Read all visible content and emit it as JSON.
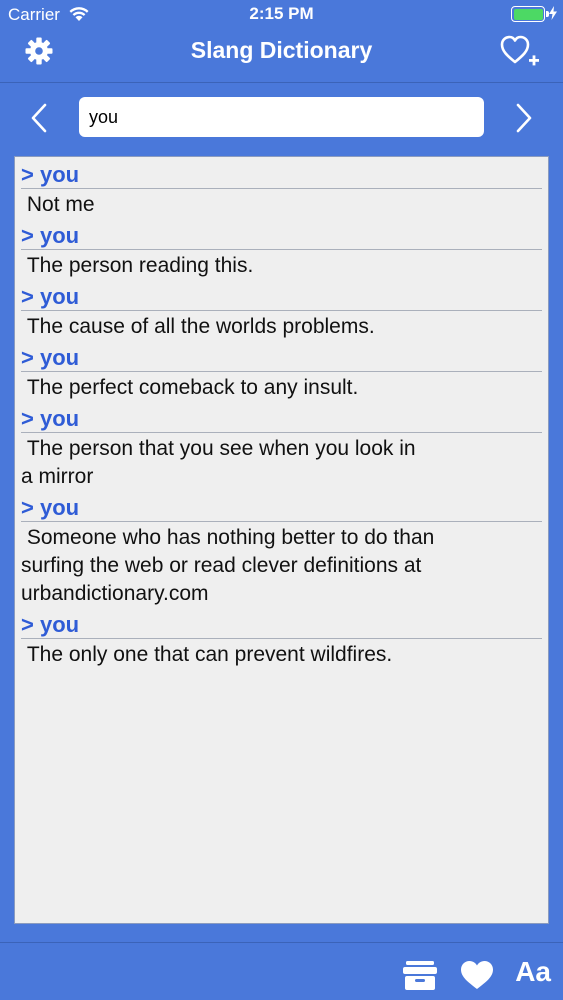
{
  "status_bar": {
    "carrier": "Carrier",
    "time": "2:15 PM"
  },
  "nav": {
    "title": "Slang Dictionary",
    "icons": [
      "gear-icon",
      "heart-plus-icon"
    ]
  },
  "search": {
    "value": "you"
  },
  "entries": [
    {
      "term": "> you",
      "definition": " Not me"
    },
    {
      "term": "> you",
      "definition": " The person reading this."
    },
    {
      "term": "> you",
      "definition": " The cause of all the worlds problems."
    },
    {
      "term": "> you",
      "definition": " The perfect comeback to any insult."
    },
    {
      "term": "> you",
      "definition": " The person that you see when you look in\na mirror"
    },
    {
      "term": "> you",
      "definition": " Someone who has nothing better to do than\nsurfing the web or read clever definitions at\nurbandictionary.com"
    },
    {
      "term": "> you",
      "definition": " The only one that can prevent wildfires."
    }
  ],
  "bottom_bar": {
    "font_label": "Aa",
    "icons": [
      "archive-icon",
      "heart-icon"
    ]
  },
  "colors": {
    "background": "#4a78da",
    "term": "#2f5cd6",
    "list_bg": "#efefef",
    "battery": "#4cd964"
  }
}
